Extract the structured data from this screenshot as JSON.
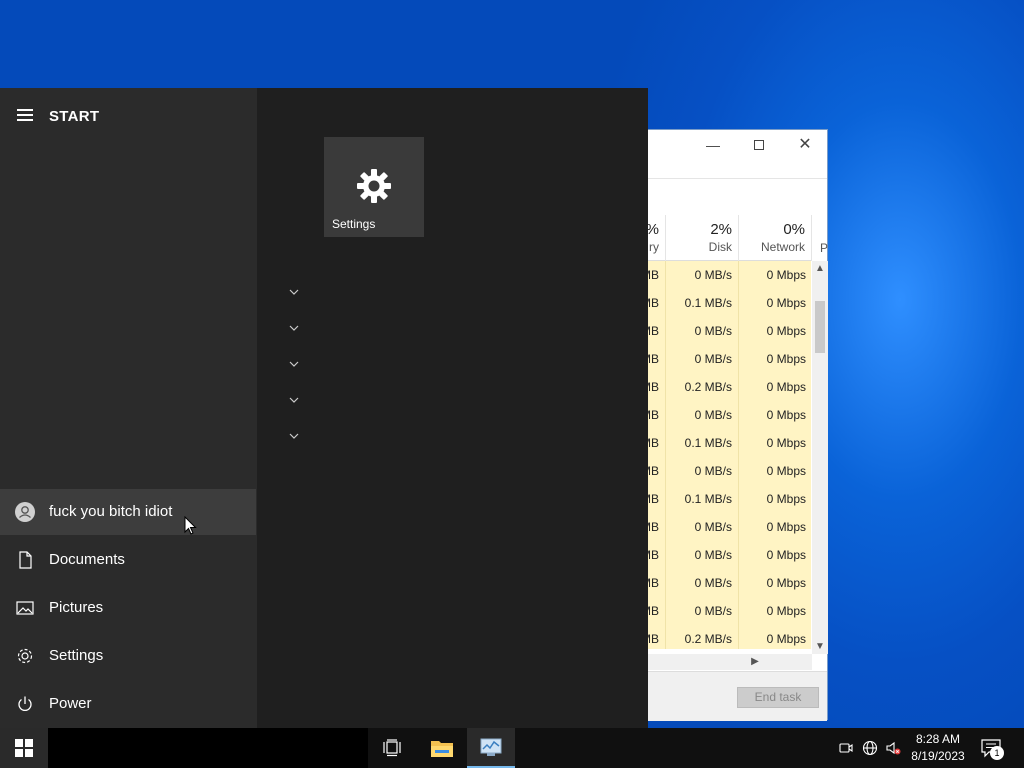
{
  "task_manager": {
    "columns": {
      "memory": {
        "pct": "%",
        "name": "ry"
      },
      "disk": {
        "pct": "2%",
        "name": "Disk"
      },
      "network": {
        "pct": "0%",
        "name": "Network"
      },
      "power": {
        "name": "P"
      }
    },
    "rows": [
      {
        "mem": "MB",
        "disk": "0 MB/s",
        "net": "0 Mbps"
      },
      {
        "mem": "MB",
        "disk": "0.1 MB/s",
        "net": "0 Mbps"
      },
      {
        "mem": "MB",
        "disk": "0 MB/s",
        "net": "0 Mbps"
      },
      {
        "mem": "MB",
        "disk": "0 MB/s",
        "net": "0 Mbps"
      },
      {
        "mem": "MB",
        "disk": "0.2 MB/s",
        "net": "0 Mbps"
      },
      {
        "mem": "MB",
        "disk": "0 MB/s",
        "net": "0 Mbps"
      },
      {
        "mem": "MB",
        "disk": "0.1 MB/s",
        "net": "0 Mbps"
      },
      {
        "mem": "MB",
        "disk": "0 MB/s",
        "net": "0 Mbps"
      },
      {
        "mem": "MB",
        "disk": "0.1 MB/s",
        "net": "0 Mbps"
      },
      {
        "mem": "MB",
        "disk": "0 MB/s",
        "net": "0 Mbps"
      },
      {
        "mem": "MB",
        "disk": "0 MB/s",
        "net": "0 Mbps"
      },
      {
        "mem": "MB",
        "disk": "0 MB/s",
        "net": "0 Mbps"
      },
      {
        "mem": "MB",
        "disk": "0 MB/s",
        "net": "0 Mbps"
      },
      {
        "mem": "MB",
        "disk": "0.2 MB/s",
        "net": "0 Mbps"
      }
    ],
    "end_task_label": "End task"
  },
  "start_menu": {
    "title": "START",
    "user_name": "fuck you bitch idiot",
    "items": {
      "documents": "Documents",
      "pictures": "Pictures",
      "settings": "Settings",
      "power": "Power"
    },
    "tile_settings_label": "Settings"
  },
  "taskbar": {
    "time": "8:28 AM",
    "date": "8/19/2023",
    "notification_count": "1",
    "accent_color": "#76b9ed"
  }
}
